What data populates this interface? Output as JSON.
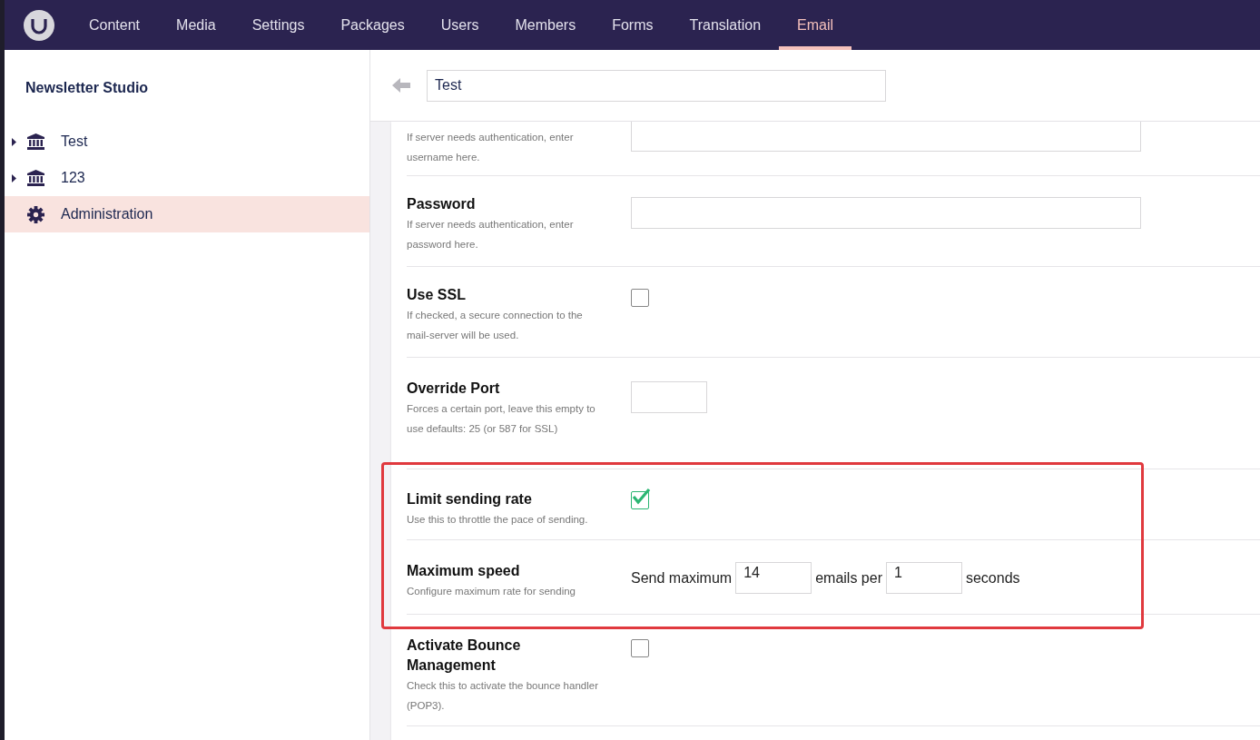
{
  "top_nav": {
    "items": [
      {
        "label": "Content",
        "selected": false
      },
      {
        "label": "Media",
        "selected": false
      },
      {
        "label": "Settings",
        "selected": false
      },
      {
        "label": "Packages",
        "selected": false
      },
      {
        "label": "Users",
        "selected": false
      },
      {
        "label": "Members",
        "selected": false
      },
      {
        "label": "Forms",
        "selected": false
      },
      {
        "label": "Translation",
        "selected": false
      },
      {
        "label": "Email",
        "selected": true
      }
    ]
  },
  "sidebar": {
    "title": "Newsletter Studio",
    "items": [
      {
        "label": "Test",
        "kind": "workspace",
        "expandable": true,
        "selected": false
      },
      {
        "label": "123",
        "kind": "workspace",
        "expandable": true,
        "selected": false
      },
      {
        "label": "Administration",
        "kind": "settings",
        "expandable": false,
        "selected": true
      }
    ]
  },
  "editor": {
    "name": "Test",
    "settings": [
      {
        "kind": "text",
        "description": "If server needs authentication, enter username here.",
        "highlighted": false
      },
      {
        "kind": "text",
        "label": "Password",
        "description": "If server needs authentication, enter password here.",
        "highlighted": false
      },
      {
        "kind": "checkbox",
        "label": "Use SSL",
        "description": "If checked, a secure connection to the mail-server will be used.",
        "checked": false,
        "highlighted": false
      },
      {
        "kind": "port",
        "label": "Override Port",
        "description": "Forces a certain port, leave this empty to use defaults: 25 (or 587 for SSL)",
        "highlighted": false
      },
      {
        "kind": "checkbox",
        "label": "Limit sending rate",
        "description": "Use this to throttle the pace of sending.",
        "checked": true,
        "highlighted": true
      },
      {
        "kind": "rate",
        "label": "Maximum speed",
        "description": "Configure maximum rate for sending",
        "prefix": "Send maximum",
        "amount": "14",
        "middle": "emails per",
        "period": "1",
        "suffix": "seconds",
        "highlighted": true
      },
      {
        "kind": "checkbox",
        "label": "Activate Bounce Management",
        "description": "Check this to activate the bounce handler (POP3).",
        "checked": false,
        "highlighted": false
      }
    ]
  }
}
